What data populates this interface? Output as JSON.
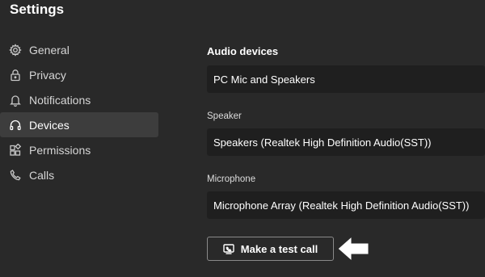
{
  "window": {
    "title": "Settings"
  },
  "sidebar": {
    "items": [
      {
        "label": "General",
        "icon": "gear-icon",
        "active": false
      },
      {
        "label": "Privacy",
        "icon": "lock-icon",
        "active": false
      },
      {
        "label": "Notifications",
        "icon": "bell-icon",
        "active": false
      },
      {
        "label": "Devices",
        "icon": "headset-icon",
        "active": true
      },
      {
        "label": "Permissions",
        "icon": "grid-icon",
        "active": false
      },
      {
        "label": "Calls",
        "icon": "phone-icon",
        "active": false
      }
    ]
  },
  "main": {
    "heading": "Audio devices",
    "audio_device": {
      "value": "PC Mic and Speakers"
    },
    "speaker": {
      "label": "Speaker",
      "value": "Speakers (Realtek High Definition Audio(SST))"
    },
    "microphone": {
      "label": "Microphone",
      "value": "Microphone Array (Realtek High Definition Audio(SST))"
    },
    "test_call_button": {
      "label": "Make a test call",
      "icon": "test-call-icon"
    },
    "annotation": {
      "icon": "arrow-left-icon"
    }
  },
  "colors": {
    "background": "#292929",
    "active_item": "#3d3d3d",
    "dropdown": "#1f1f1f",
    "text": "#ffffff"
  }
}
